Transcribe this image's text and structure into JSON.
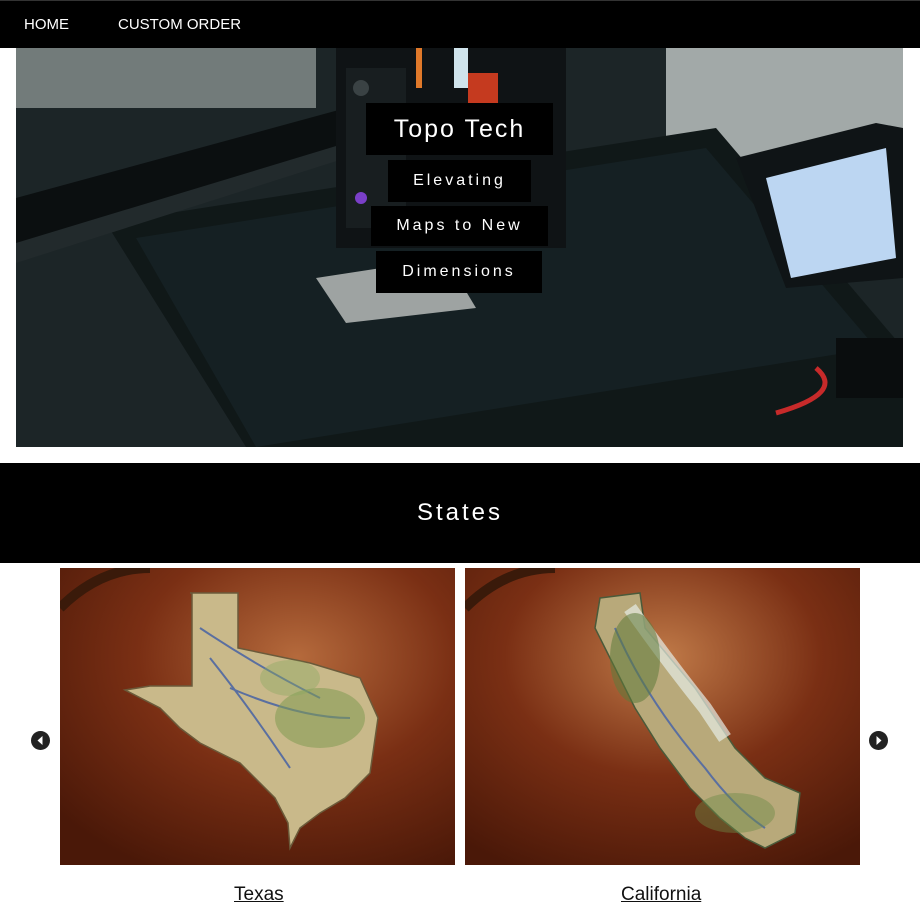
{
  "nav": {
    "home_label": "HOME",
    "custom_order_label": "CUSTOM ORDER"
  },
  "hero": {
    "title": "Topo Tech",
    "tagline_lines": [
      "Elevating",
      "Maps to New",
      "Dimensions"
    ]
  },
  "section": {
    "title": "States"
  },
  "carousel": {
    "items": [
      {
        "caption": "Texas"
      },
      {
        "caption": "California"
      }
    ],
    "prev_icon": "chevron-left-icon",
    "next_icon": "chevron-right-icon"
  },
  "colors": {
    "nav_bg": "#000000",
    "header_bg": "#000000",
    "text_on_dark": "#ffffff",
    "wood": "#7a2f14"
  }
}
